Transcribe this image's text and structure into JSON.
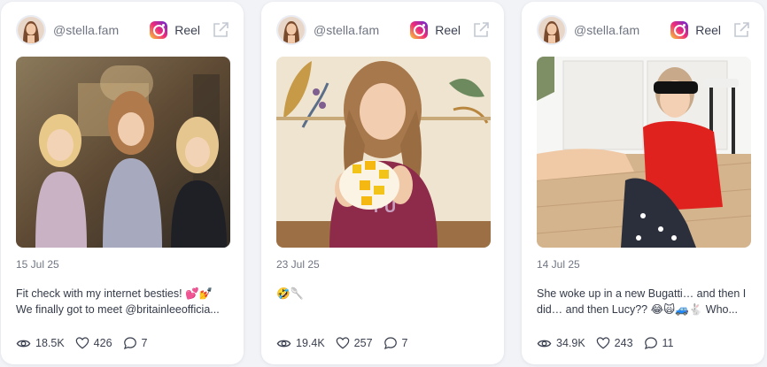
{
  "cards": [
    {
      "handle": "@stella.fam",
      "platform_icon": "instagram-icon",
      "type_label": "Reel",
      "date": "15 Jul 25",
      "caption_lines": [
        "Fit check with my internet besties! 💕💅",
        "We finally got to meet @britainleeofficia..."
      ],
      "views": "18.5K",
      "likes": "426",
      "comments": "7"
    },
    {
      "handle": "@stella.fam",
      "platform_icon": "instagram-icon",
      "type_label": "Reel",
      "date": "23 Jul 25",
      "caption_lines": [
        "🤣🥄"
      ],
      "views": "19.4K",
      "likes": "257",
      "comments": "7"
    },
    {
      "handle": "@stella.fam",
      "platform_icon": "instagram-icon",
      "type_label": "Reel",
      "date": "14 Jul 25",
      "caption_lines": [
        "She woke up in a new Bugatti… and then I",
        "did… and then Lucy?? 😂🙀🚙🐇 Who..."
      ],
      "views": "34.9K",
      "likes": "243",
      "comments": "11"
    }
  ],
  "colors": {
    "page_background": "#f1f3f7",
    "card_background": "#ffffff",
    "muted_text": "#6f7582",
    "body_text": "#333a48"
  }
}
